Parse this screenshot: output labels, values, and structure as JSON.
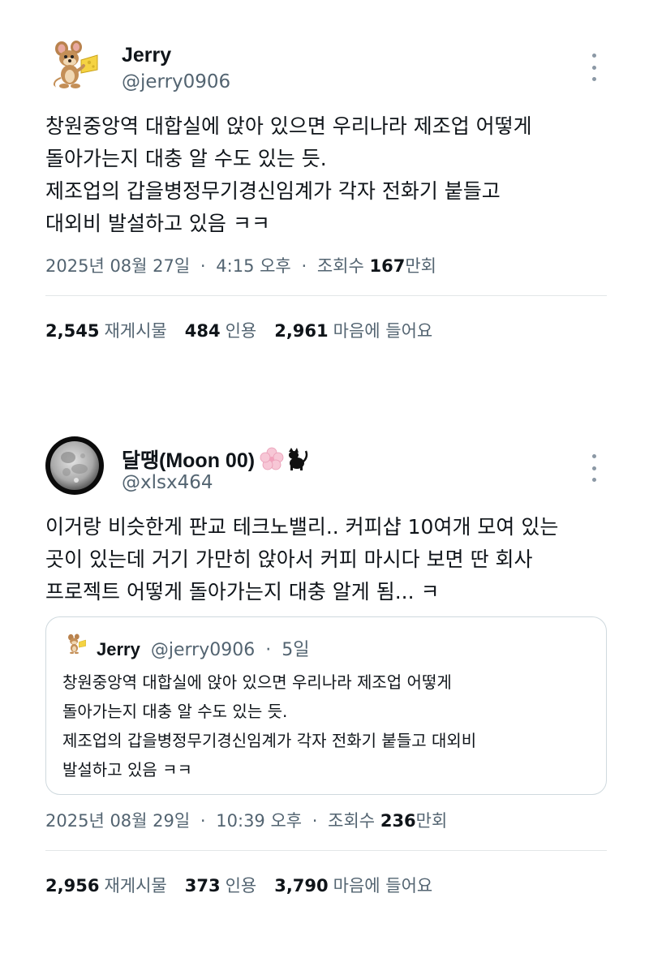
{
  "tweets": [
    {
      "display_name": "Jerry",
      "handle": "@jerry0906",
      "body_lines": [
        "창원중앙역 대합실에 앉아 있으면 우리나라 제조업 어떻게",
        "돌아가는지 대충 알 수도 있는 듯.",
        "제조업의 갑을병정무기경신임계가 각자 전화기 붙들고",
        "대외비 발설하고 있음 ㅋㅋ"
      ],
      "date": "2025년 08월 27일",
      "time": "4:15 오후",
      "views_label": "조회수",
      "views_num": "167",
      "views_unit": "만회",
      "stats": {
        "retweets": "2,545",
        "retweets_label": "재게시물",
        "quotes": "484",
        "quotes_label": "인용",
        "likes": "2,961",
        "likes_label": "마음에 들어요"
      }
    },
    {
      "display_name": "달땡(Moon 00)",
      "handle": "@xlsx464",
      "body_lines": [
        "이거랑 비슷한게 판교 테크노밸리.. 커피샵 10여개 모여 있는",
        "곳이 있는데 거기 가만히 앉아서 커피 마시다 보면 딴 회사",
        "프로젝트 어떻게 돌아가는지 대충 알게 됨... ㅋ"
      ],
      "quote": {
        "display_name": "Jerry",
        "handle": "@jerry0906",
        "age": "5일",
        "body_lines": [
          "창원중앙역 대합실에 앉아 있으면 우리나라 제조업 어떻게",
          "돌아가는지 대충 알 수도 있는 듯.",
          "제조업의 갑을병정무기경신임계가 각자 전화기 붙들고 대외비",
          "발설하고 있음 ㅋㅋ"
        ]
      },
      "date": "2025년 08월 29일",
      "time": "10:39 오후",
      "views_label": "조회수",
      "views_num": "236",
      "views_unit": "만회",
      "stats": {
        "retweets": "2,956",
        "retweets_label": "재게시물",
        "quotes": "373",
        "quotes_label": "인용",
        "likes": "3,790",
        "likes_label": "마음에 들어요"
      }
    }
  ],
  "separator": "·",
  "icons": [
    "mouse-cartoon-avatar",
    "moon-avatar",
    "blossom-emoji",
    "black-cat-emoji",
    "more-options-icon"
  ]
}
